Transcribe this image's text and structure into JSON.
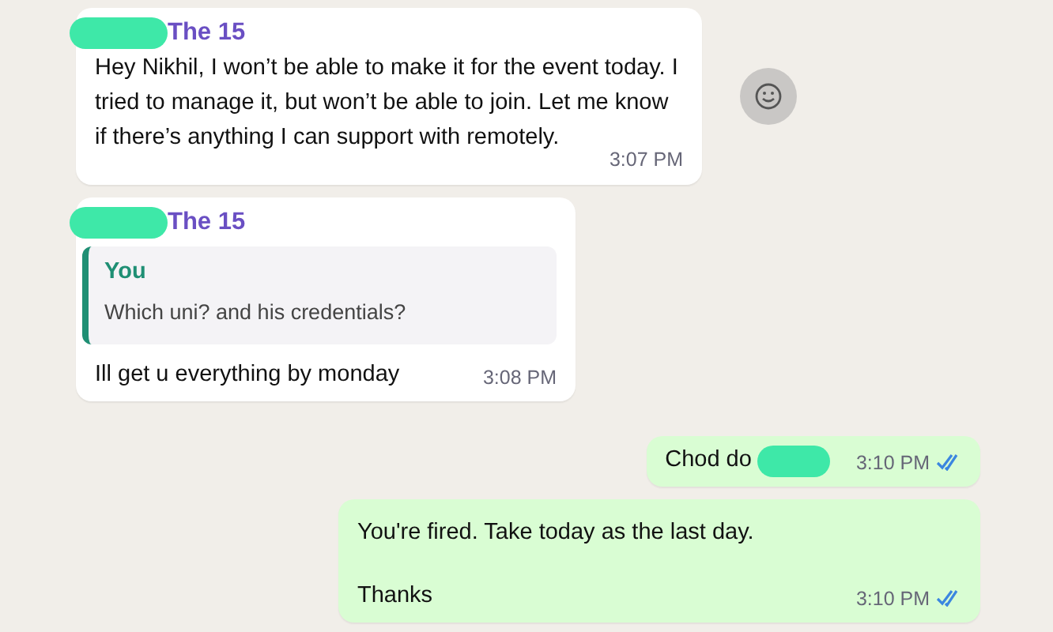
{
  "messages": [
    {
      "kind": "incoming",
      "sender": "The 15",
      "sender_redacted": true,
      "lines": [
        "Hey Nikhil, I won’t be able to make it for the event today. I tried to manage it, but won’t be able to join. Let me know if there’s anything I can support with remotely."
      ],
      "time": "3:07 PM",
      "reaction_button": true
    },
    {
      "kind": "incoming",
      "sender": "The 15",
      "sender_redacted": true,
      "quote": {
        "author": "You",
        "text": "Which uni? and his credentials?"
      },
      "lines": [
        "Ill get u everything by monday"
      ],
      "time": "3:08 PM"
    },
    {
      "kind": "outgoing",
      "lines": [
        "Chod do"
      ],
      "text_redacted": true,
      "time": "3:10 PM",
      "read": true
    },
    {
      "kind": "outgoing",
      "lines": [
        "You're fired. Take today as the last day.",
        "Thanks"
      ],
      "time": "3:10 PM",
      "read": true
    }
  ]
}
